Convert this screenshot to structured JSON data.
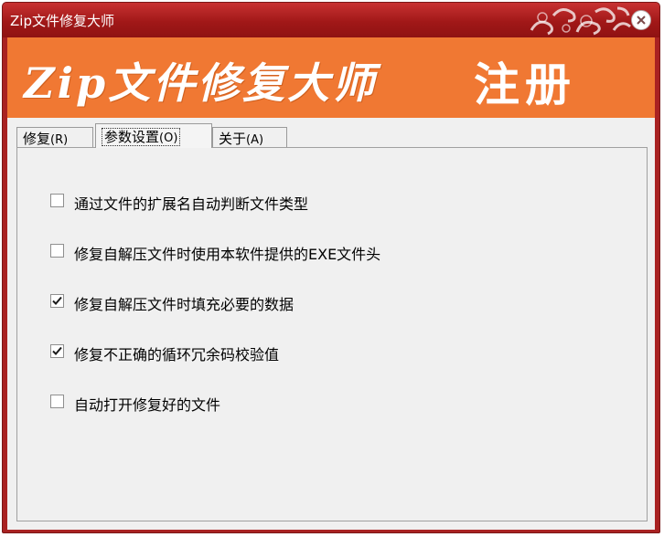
{
  "window": {
    "title": "Zip文件修复大师"
  },
  "banner": {
    "app_name": "Zip文件修复大师",
    "register_label": "注册"
  },
  "tabs": [
    {
      "label": "修复",
      "accesskey": "(R)",
      "active": false
    },
    {
      "label": "参数设置",
      "accesskey": "(O)",
      "active": true
    },
    {
      "label": "关于",
      "accesskey": "(A)",
      "active": false
    }
  ],
  "options": [
    {
      "label": "通过文件的扩展名自动判断文件类型",
      "checked": false
    },
    {
      "label": "修复自解压文件时使用本软件提供的EXE文件头",
      "checked": false
    },
    {
      "label": "修复自解压文件时填充必要的数据",
      "checked": true
    },
    {
      "label": "修复不正确的循环冗余码校验值",
      "checked": true
    },
    {
      "label": "自动打开修复好的文件",
      "checked": false
    }
  ],
  "colors": {
    "titlebar": "#a92222",
    "banner": "#f07833",
    "panel": "#f0f0f0"
  }
}
